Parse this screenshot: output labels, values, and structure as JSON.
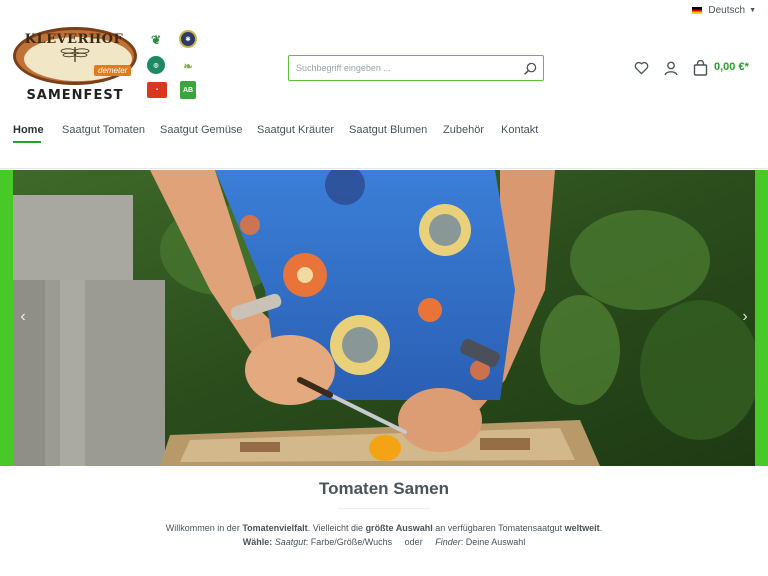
{
  "topbar": {
    "language": "Deutsch",
    "flag_icon": "german-flag-icon"
  },
  "logo": {
    "title": "KLEVERHOF",
    "badge": "demeter",
    "subtitle": "SAMENFEST"
  },
  "certifications": [
    {
      "icon": "organic-leaf-icon"
    },
    {
      "icon": "seal-icon"
    },
    {
      "icon": "eco-circle-icon"
    },
    {
      "icon": "bioverita-icon"
    },
    {
      "icon": "red-label-icon"
    },
    {
      "icon": "ab-label-icon",
      "text": "AB"
    }
  ],
  "search": {
    "placeholder": "Suchbegriff eingeben ..."
  },
  "header_actions": {
    "cart_total": "0,00 €*"
  },
  "nav": {
    "items": [
      {
        "label": "Home",
        "active": true
      },
      {
        "label": "Saatgut Tomaten"
      },
      {
        "label": "Saatgut Gemüse"
      },
      {
        "label": "Saatgut Kräuter"
      },
      {
        "label": "Saatgut Blumen"
      },
      {
        "label": "Zubehör"
      },
      {
        "label": "Kontakt"
      }
    ]
  },
  "hero": {
    "prev_icon": "chevron-left-icon",
    "next_icon": "chevron-right-icon"
  },
  "intro": {
    "title": "Tomaten Samen",
    "line1": {
      "t1": "Willkommen in der ",
      "b1": "Tomatenvielfalt",
      "t2": ". Vielleicht die ",
      "b2": "größte Auswahl",
      "t3": " an verfügbaren Tomatensaatgut ",
      "b3": "weltweit",
      "t4": "."
    },
    "line2": {
      "b1": "Wähle:",
      "i1": "Saatgut",
      "t1": ": Farbe/Größe/Wuchs",
      "t2": "oder",
      "i2": "Finder",
      "t3": ": Deine Auswahl"
    }
  },
  "colors": {
    "accent": "#27a02a",
    "search_border": "#5fbf3a",
    "hero_frame": "#49c82a",
    "text": "#4a545b"
  }
}
